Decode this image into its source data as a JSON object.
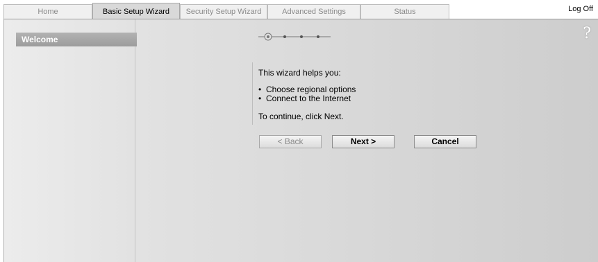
{
  "tabs": [
    {
      "label": "Home",
      "active": false
    },
    {
      "label": "Basic Setup Wizard",
      "active": true
    },
    {
      "label": "Security Setup Wizard",
      "active": false
    },
    {
      "label": "Advanced Settings",
      "active": false
    },
    {
      "label": "Status",
      "active": false
    }
  ],
  "header": {
    "logoff_label": "Log Off"
  },
  "sidebar": {
    "items": [
      {
        "label": "Welcome",
        "selected": true
      }
    ]
  },
  "wizard": {
    "step_current": 1,
    "step_total": 4,
    "help_label": "?",
    "intro": "This wizard helps you:",
    "bullets": [
      "Choose regional options",
      "Connect to the Internet"
    ],
    "continue_text": "To continue, click Next."
  },
  "buttons": {
    "back_label": "< Back",
    "next_label": "Next >",
    "cancel_label": "Cancel"
  }
}
